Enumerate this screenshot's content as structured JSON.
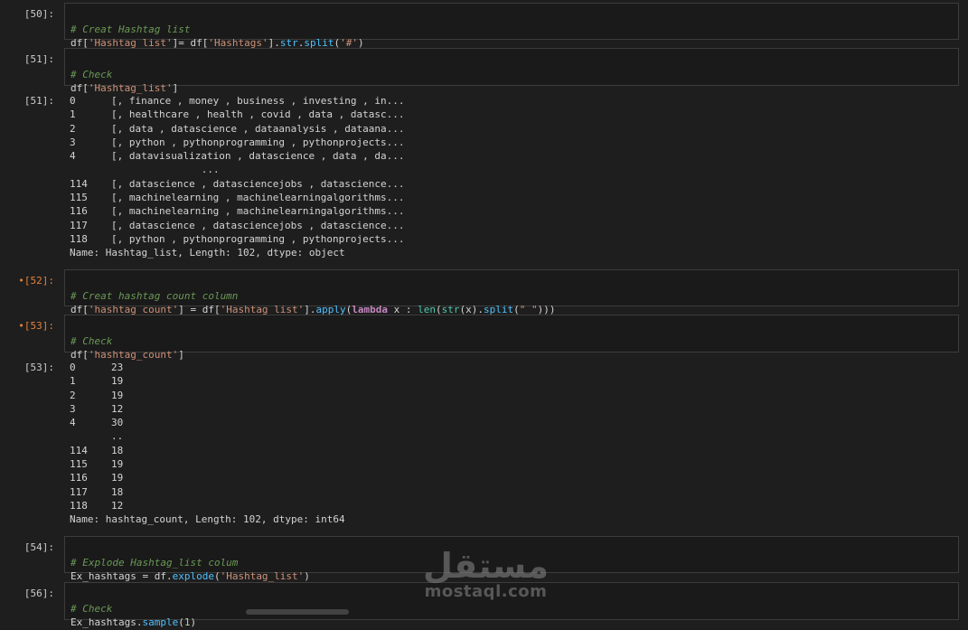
{
  "cells": [
    {
      "prompt": "[50]:",
      "dirty": false,
      "comment": "# Creat Hashtag list",
      "code": [
        "df[",
        "'Hashtag_list'",
        "]= df[",
        "'Hashtags'",
        "].",
        "str",
        ".",
        "split",
        "(",
        "'#'",
        ")"
      ]
    },
    {
      "prompt": "[51]:",
      "dirty": false,
      "comment": "# Check",
      "code": [
        "df[",
        "'Hashtag_list'",
        "]"
      ]
    },
    {
      "prompt": "•[52]:",
      "dirty": true,
      "comment": "# Creat hashtag count column",
      "code": [
        "df[",
        "'hashtag_count'",
        "] = df[",
        "'Hashtag_list'",
        "].",
        "apply",
        "(",
        "lambda",
        " x : ",
        "len",
        "(",
        "str",
        "(x).",
        "split",
        "(",
        "\" \"",
        ")))"
      ]
    },
    {
      "prompt": "•[53]:",
      "dirty": true,
      "comment": "# Check",
      "code": [
        "df[",
        "'hashtag_count'",
        "]"
      ]
    },
    {
      "prompt": "[54]:",
      "dirty": false,
      "comment": "# Explode Hashtag_list colum",
      "code": [
        "Ex_hashtags = df.",
        "explode",
        "(",
        "'Hashtag_list'",
        ")"
      ]
    },
    {
      "prompt": "[56]:",
      "dirty": false,
      "comment": "# Check",
      "code": [
        "Ex_hashtags.",
        "sample",
        "(",
        "1",
        ")"
      ]
    }
  ],
  "outputs": [
    {
      "prompt": "[51]:",
      "rows": [
        [
          "0",
          "[, finance , money , business , investing , in..."
        ],
        [
          "1",
          "[, healthcare , health , covid , data , datasc..."
        ],
        [
          "2",
          "[, data , datascience , dataanalysis , dataana..."
        ],
        [
          "3",
          "[, python , pythonprogramming , pythonprojects..."
        ],
        [
          "4",
          "[, datavisualization , datascience , data , da..."
        ],
        [
          "",
          "                      ..."
        ],
        [
          "114",
          "[, datascience , datasciencejobs , datascience..."
        ],
        [
          "115",
          "[, machinelearning , machinelearningalgorithms..."
        ],
        [
          "116",
          "[, machinelearning , machinelearningalgorithms..."
        ],
        [
          "117",
          "[, datascience , datasciencejobs , datascience..."
        ],
        [
          "118",
          "[, python , pythonprogramming , pythonprojects..."
        ]
      ],
      "footer": "Name: Hashtag_list, Length: 102, dtype: object"
    },
    {
      "prompt": "[53]:",
      "rows": [
        [
          "0",
          "23"
        ],
        [
          "1",
          "19"
        ],
        [
          "2",
          "19"
        ],
        [
          "3",
          "12"
        ],
        [
          "4",
          "30"
        ],
        [
          "",
          "..",
          ""
        ],
        [
          "114",
          "18"
        ],
        [
          "115",
          "19"
        ],
        [
          "116",
          "19"
        ],
        [
          "117",
          "18"
        ],
        [
          "118",
          "12"
        ]
      ],
      "footer": "Name: hashtag_count, Length: 102, dtype: int64"
    }
  ],
  "watermark": {
    "arabic": "مستقل",
    "latin": "mostaql.com"
  }
}
